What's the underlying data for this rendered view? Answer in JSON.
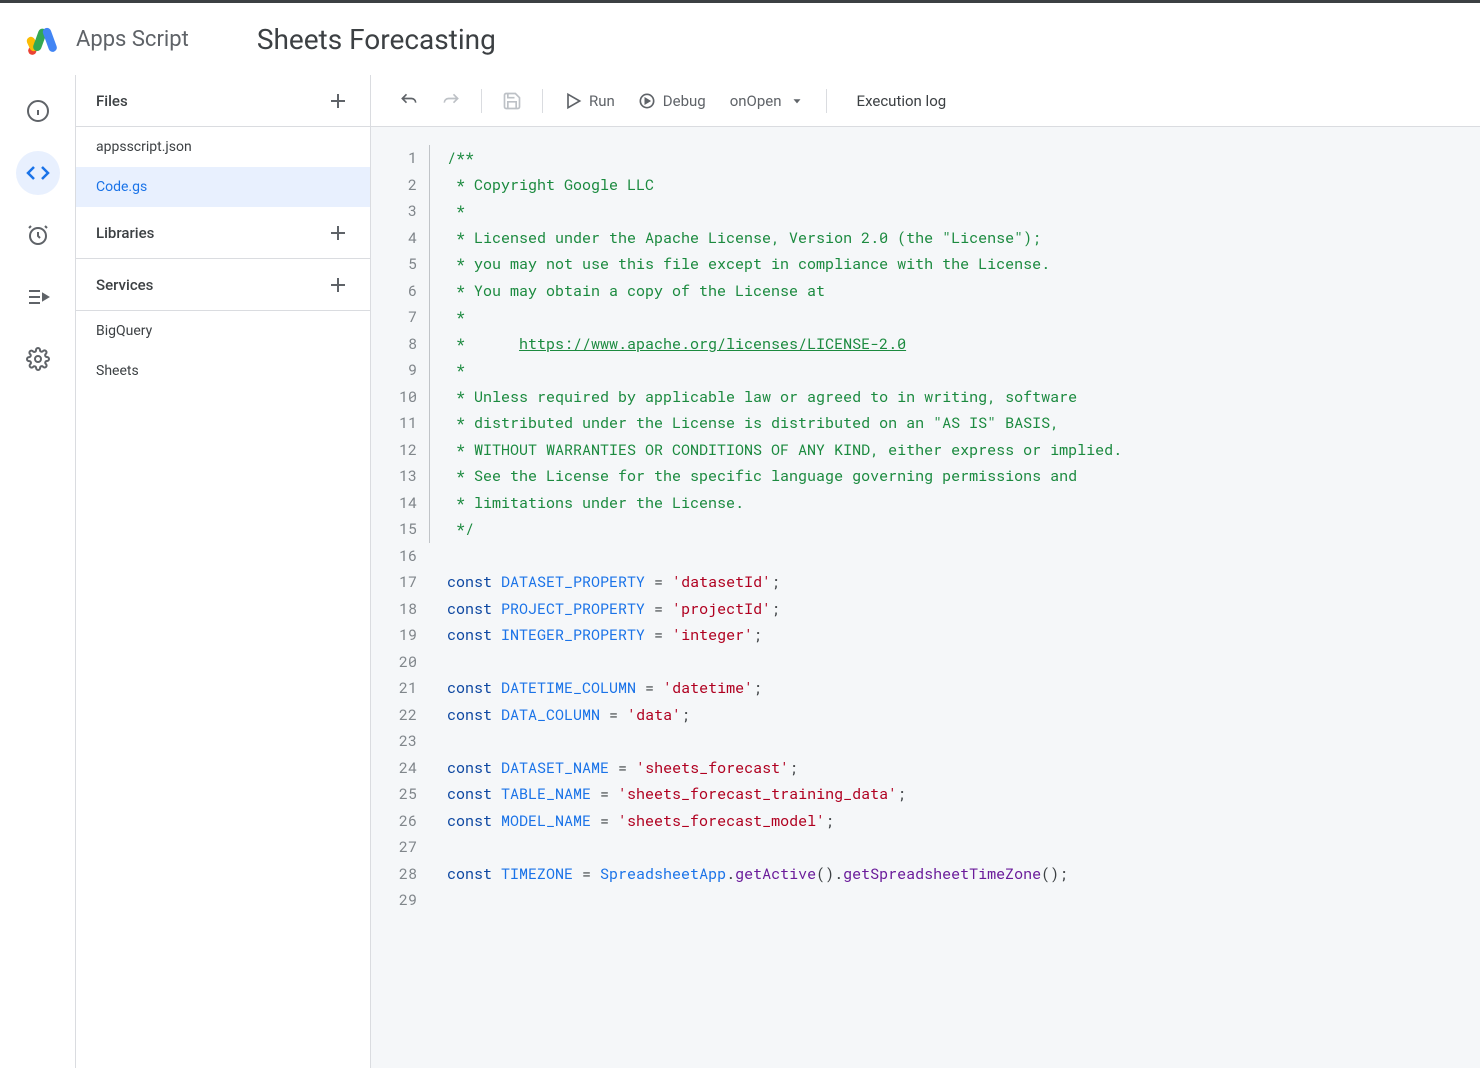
{
  "header": {
    "app_name": "Apps Script",
    "project_title": "Sheets Forecasting"
  },
  "sidebar": {
    "files_label": "Files",
    "libraries_label": "Libraries",
    "services_label": "Services",
    "files": [
      "appsscript.json",
      "Code.gs"
    ],
    "selected_file_index": 1,
    "services": [
      "BigQuery",
      "Sheets"
    ]
  },
  "toolbar": {
    "run_label": "Run",
    "debug_label": "Debug",
    "function_name": "onOpen",
    "execution_log_label": "Execution log"
  },
  "code": {
    "lines": [
      {
        "n": 1,
        "fold": true,
        "tokens": [
          [
            "/**",
            "comment"
          ]
        ]
      },
      {
        "n": 2,
        "fold": true,
        "tokens": [
          [
            " * Copyright Google LLC",
            "comment"
          ]
        ]
      },
      {
        "n": 3,
        "fold": true,
        "tokens": [
          [
            " *",
            "comment"
          ]
        ]
      },
      {
        "n": 4,
        "fold": true,
        "tokens": [
          [
            " * Licensed under the Apache License, Version 2.0 (the \"License\");",
            "comment"
          ]
        ]
      },
      {
        "n": 5,
        "fold": true,
        "tokens": [
          [
            " * you may not use this file except in compliance with the License.",
            "comment"
          ]
        ]
      },
      {
        "n": 6,
        "fold": true,
        "tokens": [
          [
            " * You may obtain a copy of the License at",
            "comment"
          ]
        ]
      },
      {
        "n": 7,
        "fold": true,
        "tokens": [
          [
            " *",
            "comment"
          ]
        ]
      },
      {
        "n": 8,
        "fold": true,
        "tokens": [
          [
            " *      ",
            "comment"
          ],
          [
            "https://www.apache.org/licenses/LICENSE-2.0",
            "comment underline"
          ]
        ]
      },
      {
        "n": 9,
        "fold": true,
        "tokens": [
          [
            " *",
            "comment"
          ]
        ]
      },
      {
        "n": 10,
        "fold": true,
        "tokens": [
          [
            " * Unless required by applicable law or agreed to in writing, software",
            "comment"
          ]
        ]
      },
      {
        "n": 11,
        "fold": true,
        "tokens": [
          [
            " * distributed under the License is distributed on an \"AS IS\" BASIS,",
            "comment"
          ]
        ]
      },
      {
        "n": 12,
        "fold": true,
        "tokens": [
          [
            " * WITHOUT WARRANTIES OR CONDITIONS OF ANY KIND, either express or implied.",
            "comment"
          ]
        ]
      },
      {
        "n": 13,
        "fold": true,
        "tokens": [
          [
            " * See the License for the specific language governing permissions and",
            "comment"
          ]
        ]
      },
      {
        "n": 14,
        "fold": true,
        "tokens": [
          [
            " * limitations under the License.",
            "comment"
          ]
        ]
      },
      {
        "n": 15,
        "fold": true,
        "tokens": [
          [
            " */",
            "comment"
          ]
        ]
      },
      {
        "n": 16,
        "fold": false,
        "tokens": [
          [
            "",
            "punct"
          ]
        ]
      },
      {
        "n": 17,
        "fold": false,
        "tokens": [
          [
            "const ",
            "keyword"
          ],
          [
            "DATASET_PROPERTY",
            "var"
          ],
          [
            " = ",
            "punct"
          ],
          [
            "'datasetId'",
            "string"
          ],
          [
            ";",
            "punct"
          ]
        ]
      },
      {
        "n": 18,
        "fold": false,
        "tokens": [
          [
            "const ",
            "keyword"
          ],
          [
            "PROJECT_PROPERTY",
            "var"
          ],
          [
            " = ",
            "punct"
          ],
          [
            "'projectId'",
            "string"
          ],
          [
            ";",
            "punct"
          ]
        ]
      },
      {
        "n": 19,
        "fold": false,
        "tokens": [
          [
            "const ",
            "keyword"
          ],
          [
            "INTEGER_PROPERTY",
            "var"
          ],
          [
            " = ",
            "punct"
          ],
          [
            "'integer'",
            "string"
          ],
          [
            ";",
            "punct"
          ]
        ]
      },
      {
        "n": 20,
        "fold": false,
        "tokens": [
          [
            "",
            "punct"
          ]
        ]
      },
      {
        "n": 21,
        "fold": false,
        "tokens": [
          [
            "const ",
            "keyword"
          ],
          [
            "DATETIME_COLUMN",
            "var"
          ],
          [
            " = ",
            "punct"
          ],
          [
            "'datetime'",
            "string"
          ],
          [
            ";",
            "punct"
          ]
        ]
      },
      {
        "n": 22,
        "fold": false,
        "tokens": [
          [
            "const ",
            "keyword"
          ],
          [
            "DATA_COLUMN",
            "var"
          ],
          [
            " = ",
            "punct"
          ],
          [
            "'data'",
            "string"
          ],
          [
            ";",
            "punct"
          ]
        ]
      },
      {
        "n": 23,
        "fold": false,
        "tokens": [
          [
            "",
            "punct"
          ]
        ]
      },
      {
        "n": 24,
        "fold": false,
        "tokens": [
          [
            "const ",
            "keyword"
          ],
          [
            "DATASET_NAME",
            "var"
          ],
          [
            " = ",
            "punct"
          ],
          [
            "'sheets_forecast'",
            "string"
          ],
          [
            ";",
            "punct"
          ]
        ]
      },
      {
        "n": 25,
        "fold": false,
        "tokens": [
          [
            "const ",
            "keyword"
          ],
          [
            "TABLE_NAME",
            "var"
          ],
          [
            " = ",
            "punct"
          ],
          [
            "'sheets_forecast_training_data'",
            "string"
          ],
          [
            ";",
            "punct"
          ]
        ]
      },
      {
        "n": 26,
        "fold": false,
        "tokens": [
          [
            "const ",
            "keyword"
          ],
          [
            "MODEL_NAME",
            "var"
          ],
          [
            " = ",
            "punct"
          ],
          [
            "'sheets_forecast_model'",
            "string"
          ],
          [
            ";",
            "punct"
          ]
        ]
      },
      {
        "n": 27,
        "fold": false,
        "tokens": [
          [
            "",
            "punct"
          ]
        ]
      },
      {
        "n": 28,
        "fold": false,
        "tokens": [
          [
            "const ",
            "keyword"
          ],
          [
            "TIMEZONE",
            "var"
          ],
          [
            " = ",
            "punct"
          ],
          [
            "SpreadsheetApp",
            "var"
          ],
          [
            ".",
            "punct"
          ],
          [
            "getActive",
            "method"
          ],
          [
            "().",
            "punct"
          ],
          [
            "getSpreadsheetTimeZone",
            "method"
          ],
          [
            "();",
            "punct"
          ]
        ]
      },
      {
        "n": 29,
        "fold": false,
        "tokens": [
          [
            "",
            "punct"
          ]
        ]
      }
    ]
  }
}
